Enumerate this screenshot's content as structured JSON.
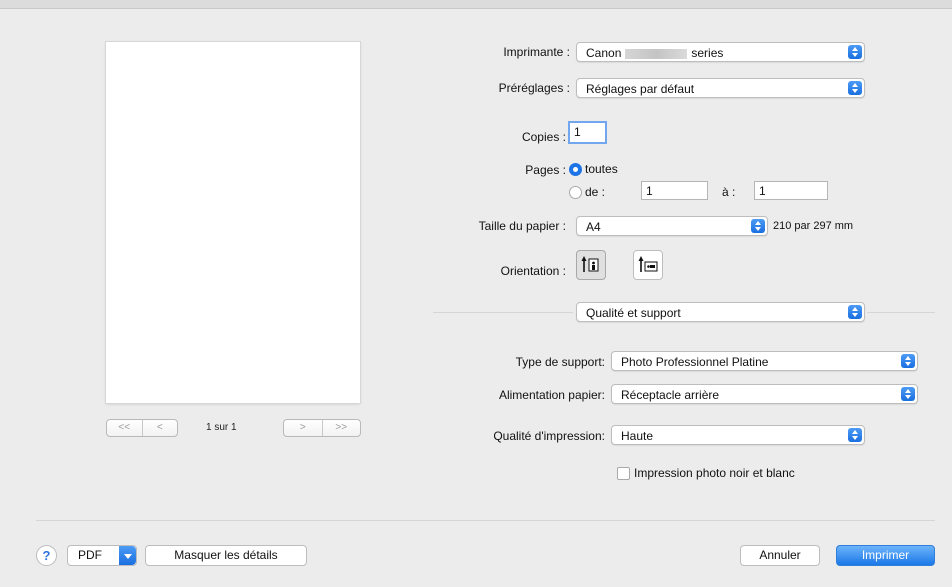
{
  "printer": {
    "label": "Imprimante :",
    "value_prefix": "Canon",
    "value_suffix": "series"
  },
  "presets": {
    "label": "Préréglages :",
    "value": "Réglages par défaut"
  },
  "copies": {
    "label": "Copies :",
    "value": "1"
  },
  "pages": {
    "label": "Pages :",
    "all_label": "toutes",
    "from_label": "de :",
    "from_value": "1",
    "to_label": "à :",
    "to_value": "1",
    "selected": "toutes"
  },
  "paper_size": {
    "label": "Taille du papier :",
    "value": "A4",
    "dimensions": "210 par 297 mm"
  },
  "orientation": {
    "label": "Orientation :",
    "selected": "portrait"
  },
  "section_popup": {
    "value": "Qualité et support"
  },
  "media_type": {
    "label": "Type de support:",
    "value": "Photo Professionnel Platine"
  },
  "paper_source": {
    "label": "Alimentation papier:",
    "value": "Réceptacle arrière"
  },
  "print_quality": {
    "label": "Qualité d'impression:",
    "value": "Haute"
  },
  "grayscale": {
    "label": "Impression photo noir et blanc",
    "checked": false
  },
  "preview_nav": {
    "first": "<<",
    "prev": "<",
    "next": ">",
    "last": ">>",
    "page_count": "1 sur 1"
  },
  "footer": {
    "help": "?",
    "pdf": "PDF",
    "hide_details": "Masquer les détails",
    "cancel": "Annuler",
    "print": "Imprimer"
  }
}
